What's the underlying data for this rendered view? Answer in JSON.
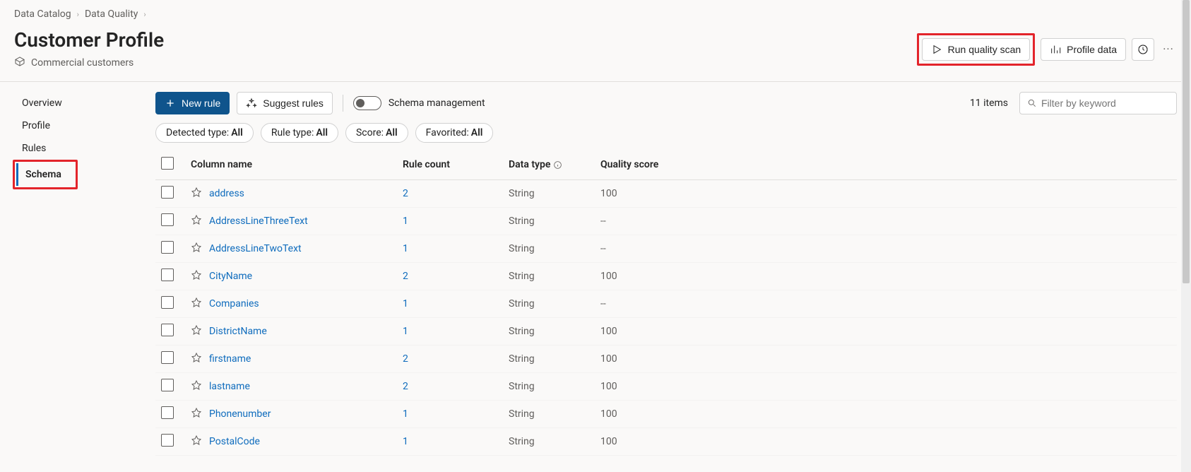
{
  "breadcrumb": {
    "items": [
      "Data Catalog",
      "Data Quality"
    ]
  },
  "header": {
    "title": "Customer Profile",
    "subtitle": "Commercial customers",
    "actions": {
      "run_scan": "Run quality scan",
      "profile_data": "Profile data"
    }
  },
  "sidenav": {
    "items": [
      {
        "label": "Overview",
        "active": false
      },
      {
        "label": "Profile",
        "active": false
      },
      {
        "label": "Rules",
        "active": false
      },
      {
        "label": "Schema",
        "active": true
      }
    ]
  },
  "toolbar": {
    "new_rule": "New rule",
    "suggest_rules": "Suggest rules",
    "schema_mgmt": "Schema management",
    "count_text": "11 items",
    "filter_placeholder": "Filter by keyword"
  },
  "pills": [
    {
      "label": "Detected type:",
      "value": "All"
    },
    {
      "label": "Rule type:",
      "value": "All"
    },
    {
      "label": "Score:",
      "value": "All"
    },
    {
      "label": "Favorited:",
      "value": "All"
    }
  ],
  "table": {
    "columns": {
      "name": "Column name",
      "rule_count": "Rule count",
      "data_type": "Data type",
      "quality_score": "Quality score"
    },
    "rows": [
      {
        "name": "address",
        "rule_count": "2",
        "data_type": "String",
        "quality_score": "100"
      },
      {
        "name": "AddressLineThreeText",
        "rule_count": "1",
        "data_type": "String",
        "quality_score": "--"
      },
      {
        "name": "AddressLineTwoText",
        "rule_count": "1",
        "data_type": "String",
        "quality_score": "--"
      },
      {
        "name": "CityName",
        "rule_count": "2",
        "data_type": "String",
        "quality_score": "100"
      },
      {
        "name": "Companies",
        "rule_count": "1",
        "data_type": "String",
        "quality_score": "--"
      },
      {
        "name": "DistrictName",
        "rule_count": "1",
        "data_type": "String",
        "quality_score": "100"
      },
      {
        "name": "firstname",
        "rule_count": "2",
        "data_type": "String",
        "quality_score": "100"
      },
      {
        "name": "lastname",
        "rule_count": "2",
        "data_type": "String",
        "quality_score": "100"
      },
      {
        "name": "Phonenumber",
        "rule_count": "1",
        "data_type": "String",
        "quality_score": "100"
      },
      {
        "name": "PostalCode",
        "rule_count": "1",
        "data_type": "String",
        "quality_score": "100"
      }
    ]
  }
}
